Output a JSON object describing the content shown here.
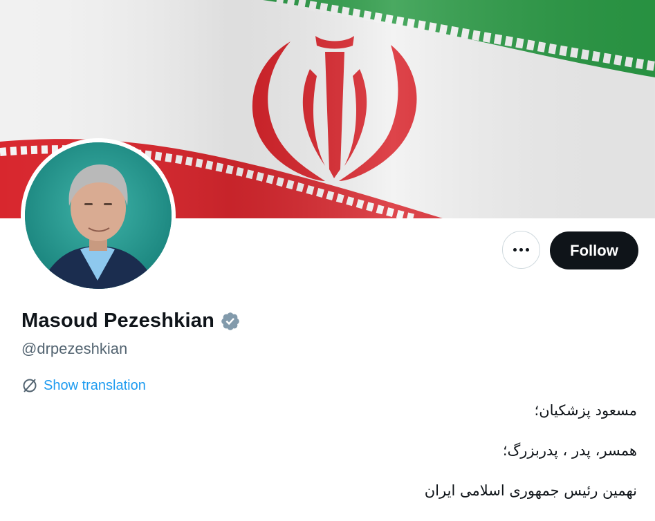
{
  "profile": {
    "display_name": "Masoud Pezeshkian",
    "handle": "@drpezeshkian",
    "verified_icon": "verified-badge-icon",
    "verified_color": "#829aab"
  },
  "actions": {
    "more_icon": "more-horizontal-icon",
    "follow_label": "Follow"
  },
  "translation": {
    "icon": "translate-icon",
    "label": "Show translation"
  },
  "bio": {
    "lines": [
      "مسعود پزشکیان؛",
      "همسر، پدر ، پدربزرگ؛",
      "نهمین رئیس جمهوری اسلامی ایران"
    ]
  },
  "colors": {
    "accent": "#1d9bf0",
    "follow_bg": "#0f1419",
    "flag_green": "#239f40",
    "flag_red": "#da0000"
  }
}
